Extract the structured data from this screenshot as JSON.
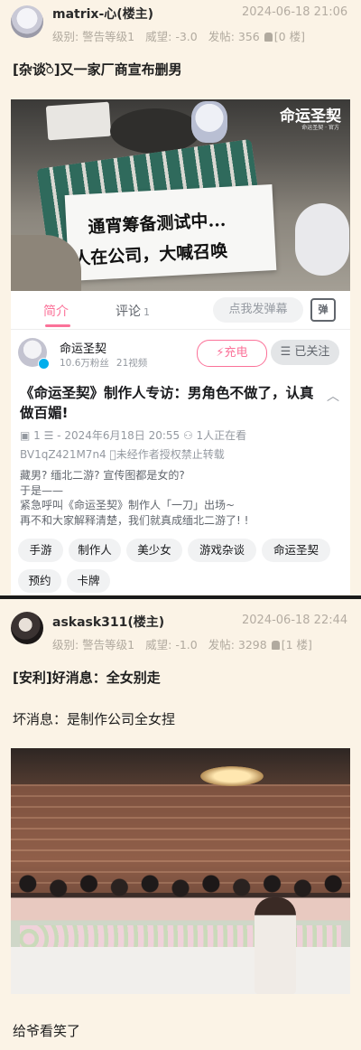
{
  "post1": {
    "username": "matrix-心(楼主)",
    "datetime": "2024-06-18 21:06",
    "meta": {
      "level": "级别: 警告等级1",
      "prestige": "威望: -3.0",
      "posts": "发帖: 356",
      "floor": "[0 楼]"
    },
    "title": "[杂谈ॆ]又一家厂商宣布删男",
    "embedded": {
      "paper_line1": "通宵筹备测试中...",
      "paper_line2": "人在公司，大喊召唤",
      "logo": "命运圣契",
      "logo_sub": "命运圣契 · 官方",
      "tabs": {
        "intro": "简介",
        "comments": "评论",
        "comments_count": "1"
      },
      "danmaku_placeholder": "点我发弹幕",
      "danmaku_icon_text": "弹",
      "uploader": {
        "name": "命运圣契",
        "fans": "10.6万粉丝",
        "videos": "21视频"
      },
      "charge_label": "⚡充电",
      "follow_label": "☰ 已关注",
      "video_title": "《命运圣契》制作人专访：男角色不做了，认真做百媚!",
      "stats_line": "▣ 1  ☰ -  2024年6月18日 20:55  ⚇ 1人正在看",
      "bvid": "BV1qZ421M7n4",
      "copyright": "未经作者授权禁止转载",
      "description": [
        "藏男? 缅北二游? 宣传图都是女的?",
        "于是——",
        "紧急呼叫《命运圣契》制作人「一刀」出场~",
        "再不和大家解释清楚，我们就真成缅北二游了! !"
      ],
      "tags": [
        "手游",
        "制作人",
        "美少女",
        "游戏杂谈",
        "命运圣契",
        "预约",
        "卡牌"
      ]
    }
  },
  "post2": {
    "username": "askask311(楼主)",
    "datetime": "2024-06-18 22:44",
    "meta": {
      "level": "级别: 警告等级1",
      "prestige": "威望: -1.0",
      "posts": "发帖: 3298",
      "floor": "[1 楼]"
    },
    "title": "[安利]好消息：全女别走",
    "line2": "坏消息：是制作公司全女捏",
    "line3": "给爷看笑了"
  }
}
